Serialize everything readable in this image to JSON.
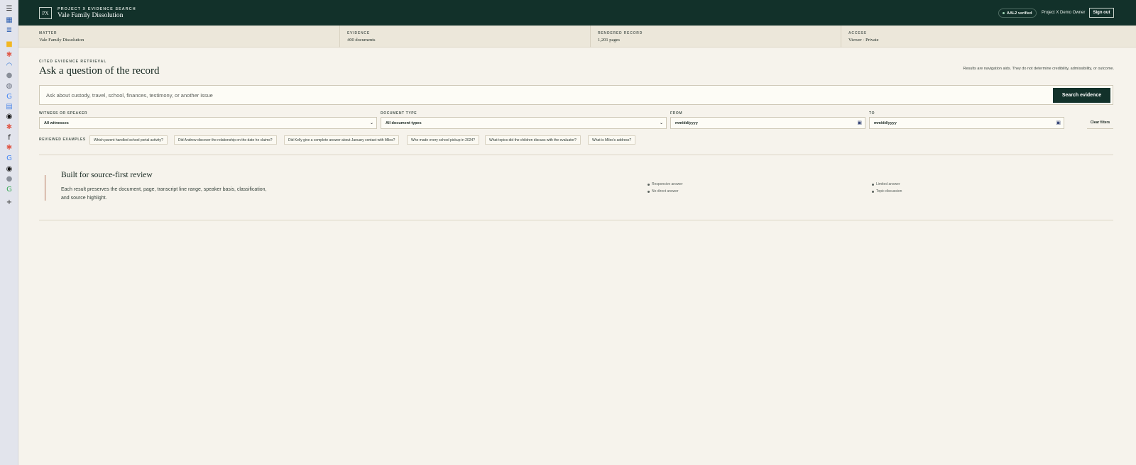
{
  "header": {
    "logo": "PX",
    "kicker": "PROJECT X EVIDENCE SEARCH",
    "title": "Vale Family Dissolution",
    "verified_badge": "AAL2 verified",
    "user": "Project X Demo Owner",
    "sign_out": "Sign out"
  },
  "summary": [
    {
      "label": "MATTER",
      "value": "Vale Family Dissolution"
    },
    {
      "label": "EVIDENCE",
      "value": "400 documents"
    },
    {
      "label": "RENDERED RECORD",
      "value": "1,201 pages"
    },
    {
      "label": "ACCESS",
      "value": "Viewer · Private"
    }
  ],
  "main": {
    "kicker": "CITED EVIDENCE RETRIEVAL",
    "title": "Ask a question of the record",
    "disclaimer": "Results are navigation aids. They do not determine credibility, admissibility, or outcome.",
    "search_placeholder": "Ask about custody, travel, school, finances, testimony, or another issue",
    "search_button": "Search evidence"
  },
  "filters": {
    "witness_label": "WITNESS OR SPEAKER",
    "witness_value": "All witnesses",
    "doctype_label": "DOCUMENT TYPE",
    "doctype_value": "All document types",
    "from_label": "FROM",
    "from_value": "mm/dd/yyyy",
    "to_label": "TO",
    "to_value": "mm/dd/yyyy",
    "clear": "Clear filters"
  },
  "examples": {
    "label": "REVIEWED EXAMPLES",
    "items": [
      "Which parent handled school portal activity?",
      "Did Andrew discover the relationship on the date he claims?",
      "Did Kelly give a complete answer about January contact with Miles?",
      "Who made every school pickup in 2024?",
      "What topics did the children discuss with the evaluator?",
      "What is Miles's address?"
    ]
  },
  "feature": {
    "title": "Built for source-first review",
    "description": "Each result preserves the document, page, transcript line range, speaker basis, classification, and source highlight.",
    "legend": [
      "Responsive answer",
      "No direct answer",
      "Limited answer",
      "Topic discussion"
    ]
  },
  "rail": {
    "icons": [
      {
        "name": "sidebar-toggle-icon",
        "glyph": "☰",
        "color": ""
      },
      {
        "name": "tabs-grid-icon",
        "glyph": "▦",
        "color": "#2a5db0"
      },
      {
        "name": "reading-list-icon",
        "glyph": "≣",
        "color": "#2a5db0"
      },
      {
        "name": "folder-icon",
        "glyph": "■",
        "color": "#f2b722"
      },
      {
        "name": "app-red-icon",
        "glyph": "✱",
        "color": "#e05a4a"
      },
      {
        "name": "app-blue-arc-icon",
        "glyph": "◠",
        "color": "#3a7bd5"
      },
      {
        "name": "app-grey-icon",
        "glyph": "●",
        "color": "#8a8f99"
      },
      {
        "name": "app-globe-icon",
        "glyph": "◍",
        "color": "#6b7180"
      },
      {
        "name": "google-icon",
        "glyph": "G",
        "color": "#4285f4"
      },
      {
        "name": "docs-icon",
        "glyph": "▤",
        "color": "#4a86e8"
      },
      {
        "name": "app-dark-icon",
        "glyph": "◉",
        "color": "#111111"
      },
      {
        "name": "app-red-2-icon",
        "glyph": "✱",
        "color": "#e05a4a"
      },
      {
        "name": "app-black-icon",
        "glyph": "f",
        "color": "#111111"
      },
      {
        "name": "app-red-3-icon",
        "glyph": "✱",
        "color": "#e05a4a"
      },
      {
        "name": "google-2-icon",
        "glyph": "G",
        "color": "#4285f4"
      },
      {
        "name": "app-dark-2-icon",
        "glyph": "◉",
        "color": "#111111"
      },
      {
        "name": "app-grey-2-icon",
        "glyph": "●",
        "color": "#8a8f99"
      },
      {
        "name": "google-3-icon",
        "glyph": "G",
        "color": "#34a853"
      },
      {
        "name": "add-tab-icon",
        "glyph": "+",
        "color": ""
      }
    ]
  }
}
